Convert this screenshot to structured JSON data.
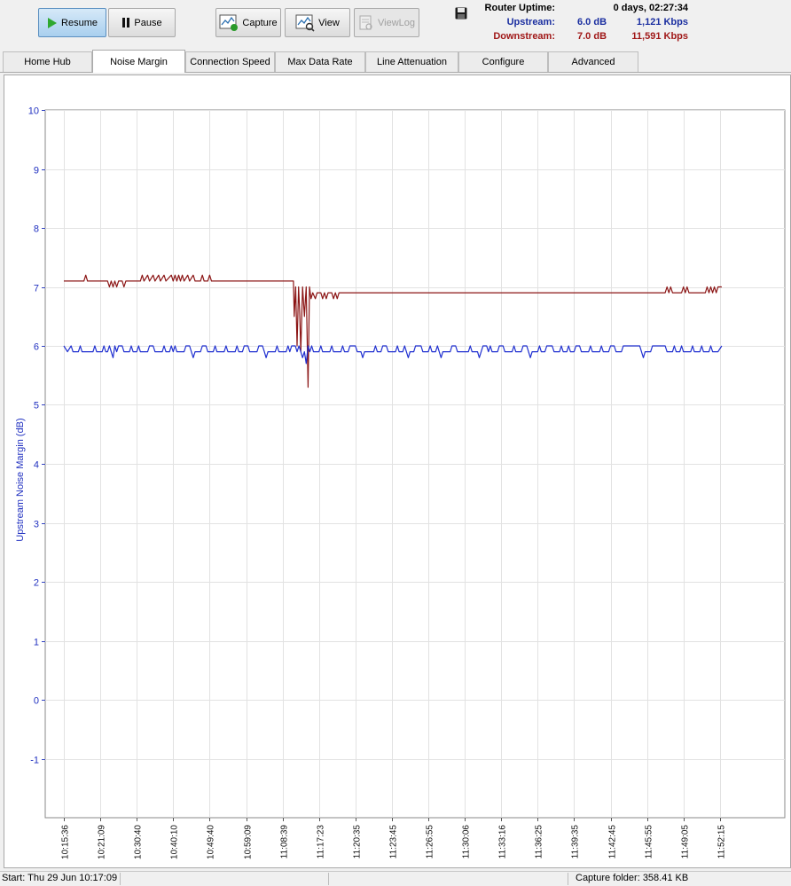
{
  "toolbar": {
    "resume_label": "Resume",
    "pause_label": "Pause",
    "capture_label": "Capture",
    "view_label": "View",
    "viewlog_label": "ViewLog"
  },
  "status": {
    "uptime_label": "Router Uptime:",
    "uptime_value": "0 days, 02:27:34",
    "upstream_label": "Upstream:",
    "upstream_db": "6.0 dB",
    "upstream_kbps": "1,121 Kbps",
    "downstream_label": "Downstream:",
    "downstream_db": "7.0 dB",
    "downstream_kbps": "11,591 Kbps"
  },
  "tabs": [
    {
      "label": "Home Hub"
    },
    {
      "label": "Noise Margin"
    },
    {
      "label": "Connection Speed"
    },
    {
      "label": "Max Data Rate"
    },
    {
      "label": "Line Attenuation"
    },
    {
      "label": "Configure"
    },
    {
      "label": "Advanced"
    }
  ],
  "statusbar": {
    "start": "Start: Thu 29 Jun 10:17:09",
    "capture_folder": "Capture folder:  358.41 KB"
  },
  "colors": {
    "upstream": "#1f2fd0",
    "downstream": "#8b1515",
    "accent": "#2a7a2a"
  },
  "chart_data": {
    "type": "line",
    "ylabel": "Upstream Noise Margin (dB)",
    "ylim": [
      -2,
      10
    ],
    "yticks": [
      10,
      9,
      8,
      7,
      6,
      5,
      4,
      3,
      2,
      1,
      0,
      -1
    ],
    "grid": true,
    "xticks": [
      "10:15:36",
      "10:21:09",
      "10:30:40",
      "10:40:10",
      "10:49:40",
      "10:59:09",
      "11:08:39",
      "11:17:23",
      "11:20:35",
      "11:23:45",
      "11:26:55",
      "11:30:06",
      "11:33:16",
      "11:36:25",
      "11:39:35",
      "11:42:45",
      "11:45:55",
      "11:49:05",
      "11:52:15"
    ],
    "series": [
      {
        "key": "downstream",
        "points": [
          [
            0,
            7.1
          ],
          [
            0.55,
            7.1
          ],
          [
            0.6,
            7.2
          ],
          [
            0.65,
            7.1
          ],
          [
            1.2,
            7.1
          ],
          [
            1.25,
            7.0
          ],
          [
            1.3,
            7.1
          ],
          [
            1.35,
            7.0
          ],
          [
            1.4,
            7.1
          ],
          [
            1.45,
            7.0
          ],
          [
            1.5,
            7.1
          ],
          [
            1.6,
            7.1
          ],
          [
            1.65,
            7.0
          ],
          [
            1.7,
            7.1
          ],
          [
            2.1,
            7.1
          ],
          [
            2.15,
            7.2
          ],
          [
            2.2,
            7.1
          ],
          [
            2.3,
            7.2
          ],
          [
            2.35,
            7.1
          ],
          [
            2.45,
            7.2
          ],
          [
            2.5,
            7.1
          ],
          [
            2.6,
            7.2
          ],
          [
            2.65,
            7.1
          ],
          [
            2.75,
            7.2
          ],
          [
            2.8,
            7.1
          ],
          [
            2.95,
            7.2
          ],
          [
            3.0,
            7.1
          ],
          [
            3.05,
            7.2
          ],
          [
            3.1,
            7.1
          ],
          [
            3.15,
            7.2
          ],
          [
            3.2,
            7.1
          ],
          [
            3.25,
            7.2
          ],
          [
            3.3,
            7.1
          ],
          [
            3.4,
            7.2
          ],
          [
            3.45,
            7.1
          ],
          [
            3.55,
            7.2
          ],
          [
            3.6,
            7.1
          ],
          [
            3.65,
            7.1
          ],
          [
            3.75,
            7.1
          ],
          [
            3.8,
            7.2
          ],
          [
            3.85,
            7.1
          ],
          [
            3.95,
            7.1
          ],
          [
            4.0,
            7.2
          ],
          [
            4.05,
            7.1
          ],
          [
            6.3,
            7.1
          ],
          [
            6.32,
            6.5
          ],
          [
            6.36,
            7.0
          ],
          [
            6.4,
            6.0
          ],
          [
            6.44,
            7.0
          ],
          [
            6.47,
            6.6
          ],
          [
            6.5,
            5.9
          ],
          [
            6.55,
            7.0
          ],
          [
            6.6,
            6.5
          ],
          [
            6.65,
            7.0
          ],
          [
            6.7,
            5.3
          ],
          [
            6.74,
            7.0
          ],
          [
            6.78,
            6.8
          ],
          [
            6.83,
            6.9
          ],
          [
            6.9,
            6.8
          ],
          [
            6.95,
            6.9
          ],
          [
            7.05,
            6.9
          ],
          [
            7.1,
            6.8
          ],
          [
            7.15,
            6.9
          ],
          [
            7.2,
            6.8
          ],
          [
            7.25,
            6.9
          ],
          [
            7.35,
            6.9
          ],
          [
            7.4,
            6.8
          ],
          [
            7.45,
            6.9
          ],
          [
            7.5,
            6.8
          ],
          [
            7.55,
            6.9
          ],
          [
            16.5,
            6.9
          ],
          [
            16.55,
            7.0
          ],
          [
            16.6,
            6.9
          ],
          [
            16.65,
            7.0
          ],
          [
            16.7,
            6.9
          ],
          [
            16.95,
            6.9
          ],
          [
            17.0,
            7.0
          ],
          [
            17.05,
            6.9
          ],
          [
            17.1,
            7.0
          ],
          [
            17.15,
            6.9
          ],
          [
            17.6,
            6.9
          ],
          [
            17.65,
            7.0
          ],
          [
            17.7,
            6.9
          ],
          [
            17.75,
            7.0
          ],
          [
            17.8,
            6.9
          ],
          [
            17.85,
            7.0
          ],
          [
            17.9,
            6.9
          ],
          [
            17.95,
            7.0
          ],
          [
            18.05,
            7.0
          ]
        ]
      },
      {
        "key": "upstream",
        "points": [
          [
            0,
            6.0
          ],
          [
            0.1,
            5.9
          ],
          [
            0.2,
            6.0
          ],
          [
            0.25,
            5.9
          ],
          [
            0.4,
            5.9
          ],
          [
            0.45,
            6.0
          ],
          [
            0.5,
            5.9
          ],
          [
            0.8,
            5.9
          ],
          [
            0.85,
            6.0
          ],
          [
            0.9,
            5.9
          ],
          [
            1.05,
            5.9
          ],
          [
            1.1,
            6.0
          ],
          [
            1.15,
            5.9
          ],
          [
            1.2,
            5.9
          ],
          [
            1.25,
            6.0
          ],
          [
            1.3,
            5.9
          ],
          [
            1.35,
            5.8
          ],
          [
            1.4,
            6.0
          ],
          [
            1.45,
            5.9
          ],
          [
            1.5,
            6.0
          ],
          [
            1.6,
            6.0
          ],
          [
            1.65,
            5.9
          ],
          [
            1.8,
            5.9
          ],
          [
            1.85,
            6.0
          ],
          [
            1.9,
            5.9
          ],
          [
            2.0,
            5.9
          ],
          [
            2.05,
            6.0
          ],
          [
            2.1,
            5.9
          ],
          [
            2.3,
            5.9
          ],
          [
            2.35,
            6.0
          ],
          [
            2.45,
            6.0
          ],
          [
            2.5,
            5.9
          ],
          [
            2.7,
            5.9
          ],
          [
            2.75,
            6.0
          ],
          [
            2.8,
            5.9
          ],
          [
            2.9,
            5.9
          ],
          [
            2.95,
            6.0
          ],
          [
            3.0,
            5.9
          ],
          [
            3.05,
            6.0
          ],
          [
            3.1,
            5.9
          ],
          [
            3.3,
            5.9
          ],
          [
            3.35,
            6.0
          ],
          [
            3.45,
            6.0
          ],
          [
            3.5,
            5.9
          ],
          [
            3.55,
            5.8
          ],
          [
            3.6,
            5.9
          ],
          [
            3.75,
            5.9
          ],
          [
            3.8,
            6.0
          ],
          [
            3.9,
            6.0
          ],
          [
            3.95,
            5.9
          ],
          [
            4.1,
            5.9
          ],
          [
            4.15,
            6.0
          ],
          [
            4.2,
            5.9
          ],
          [
            4.4,
            5.9
          ],
          [
            4.45,
            6.0
          ],
          [
            4.5,
            5.9
          ],
          [
            4.7,
            5.9
          ],
          [
            4.75,
            6.0
          ],
          [
            4.8,
            5.9
          ],
          [
            4.9,
            5.9
          ],
          [
            4.95,
            6.0
          ],
          [
            5.05,
            6.0
          ],
          [
            5.1,
            5.9
          ],
          [
            5.3,
            5.9
          ],
          [
            5.35,
            6.0
          ],
          [
            5.45,
            6.0
          ],
          [
            5.5,
            5.9
          ],
          [
            5.55,
            5.8
          ],
          [
            5.6,
            5.9
          ],
          [
            5.8,
            5.9
          ],
          [
            5.85,
            6.0
          ],
          [
            5.9,
            5.9
          ],
          [
            6.1,
            5.9
          ],
          [
            6.15,
            6.0
          ],
          [
            6.2,
            5.9
          ],
          [
            6.25,
            6.0
          ],
          [
            6.35,
            6.0
          ],
          [
            6.4,
            5.9
          ],
          [
            6.45,
            6.0
          ],
          [
            6.5,
            5.9
          ],
          [
            6.55,
            5.8
          ],
          [
            6.6,
            5.9
          ],
          [
            6.65,
            5.7
          ],
          [
            6.7,
            6.0
          ],
          [
            6.75,
            5.9
          ],
          [
            6.8,
            6.0
          ],
          [
            6.85,
            5.9
          ],
          [
            7.0,
            5.9
          ],
          [
            7.05,
            6.0
          ],
          [
            7.1,
            5.9
          ],
          [
            7.3,
            5.9
          ],
          [
            7.35,
            6.0
          ],
          [
            7.4,
            5.9
          ],
          [
            7.6,
            5.9
          ],
          [
            7.65,
            6.0
          ],
          [
            7.7,
            5.9
          ],
          [
            7.8,
            5.9
          ],
          [
            7.85,
            6.0
          ],
          [
            8.0,
            6.0
          ],
          [
            8.05,
            5.9
          ],
          [
            8.15,
            5.9
          ],
          [
            8.2,
            5.8
          ],
          [
            8.25,
            5.9
          ],
          [
            8.5,
            5.9
          ],
          [
            8.55,
            6.0
          ],
          [
            8.6,
            5.9
          ],
          [
            8.7,
            5.9
          ],
          [
            8.75,
            6.0
          ],
          [
            8.85,
            6.0
          ],
          [
            8.9,
            5.9
          ],
          [
            9.1,
            5.9
          ],
          [
            9.15,
            6.0
          ],
          [
            9.2,
            5.9
          ],
          [
            9.3,
            5.9
          ],
          [
            9.35,
            6.0
          ],
          [
            9.4,
            5.9
          ],
          [
            9.45,
            5.8
          ],
          [
            9.5,
            5.9
          ],
          [
            9.6,
            5.9
          ],
          [
            9.65,
            6.0
          ],
          [
            9.8,
            6.0
          ],
          [
            9.85,
            5.9
          ],
          [
            10.0,
            5.9
          ],
          [
            10.05,
            6.0
          ],
          [
            10.1,
            5.9
          ],
          [
            10.2,
            5.9
          ],
          [
            10.25,
            6.0
          ],
          [
            10.3,
            5.9
          ],
          [
            10.35,
            5.8
          ],
          [
            10.4,
            5.9
          ],
          [
            10.6,
            5.9
          ],
          [
            10.65,
            6.0
          ],
          [
            10.75,
            6.0
          ],
          [
            10.8,
            5.9
          ],
          [
            11.1,
            5.9
          ],
          [
            11.15,
            6.0
          ],
          [
            11.2,
            5.9
          ],
          [
            11.35,
            5.9
          ],
          [
            11.4,
            5.8
          ],
          [
            11.45,
            5.9
          ],
          [
            11.5,
            6.0
          ],
          [
            11.6,
            6.0
          ],
          [
            11.65,
            5.9
          ],
          [
            11.7,
            6.0
          ],
          [
            11.75,
            5.9
          ],
          [
            11.9,
            5.9
          ],
          [
            11.95,
            6.0
          ],
          [
            12.05,
            6.0
          ],
          [
            12.1,
            5.9
          ],
          [
            12.3,
            5.9
          ],
          [
            12.35,
            6.0
          ],
          [
            12.4,
            5.9
          ],
          [
            12.55,
            5.9
          ],
          [
            12.6,
            6.0
          ],
          [
            12.7,
            6.0
          ],
          [
            12.75,
            5.9
          ],
          [
            12.8,
            5.8
          ],
          [
            12.85,
            5.9
          ],
          [
            13.0,
            5.9
          ],
          [
            13.05,
            6.0
          ],
          [
            13.1,
            5.9
          ],
          [
            13.2,
            5.9
          ],
          [
            13.25,
            6.0
          ],
          [
            13.4,
            6.0
          ],
          [
            13.45,
            5.9
          ],
          [
            13.6,
            5.9
          ],
          [
            13.65,
            6.0
          ],
          [
            13.7,
            5.9
          ],
          [
            13.8,
            5.9
          ],
          [
            13.85,
            6.0
          ],
          [
            13.9,
            5.9
          ],
          [
            14.0,
            5.9
          ],
          [
            14.05,
            6.0
          ],
          [
            14.15,
            6.0
          ],
          [
            14.2,
            5.9
          ],
          [
            14.4,
            5.9
          ],
          [
            14.45,
            6.0
          ],
          [
            14.5,
            5.9
          ],
          [
            14.7,
            5.9
          ],
          [
            14.75,
            6.0
          ],
          [
            14.8,
            5.9
          ],
          [
            14.95,
            5.9
          ],
          [
            15.0,
            6.0
          ],
          [
            15.1,
            6.0
          ],
          [
            15.15,
            5.9
          ],
          [
            15.3,
            5.9
          ],
          [
            15.35,
            6.0
          ],
          [
            15.8,
            6.0
          ],
          [
            15.85,
            5.9
          ],
          [
            15.9,
            5.8
          ],
          [
            15.95,
            5.9
          ],
          [
            16.1,
            5.9
          ],
          [
            16.15,
            6.0
          ],
          [
            16.5,
            6.0
          ],
          [
            16.55,
            5.9
          ],
          [
            16.7,
            5.9
          ],
          [
            16.75,
            6.0
          ],
          [
            16.8,
            5.9
          ],
          [
            16.9,
            5.9
          ],
          [
            16.95,
            6.0
          ],
          [
            17.0,
            5.9
          ],
          [
            17.2,
            5.9
          ],
          [
            17.25,
            6.0
          ],
          [
            17.3,
            5.9
          ],
          [
            17.45,
            5.9
          ],
          [
            17.5,
            6.0
          ],
          [
            17.55,
            5.9
          ],
          [
            17.7,
            5.9
          ],
          [
            17.75,
            6.0
          ],
          [
            17.8,
            5.9
          ],
          [
            17.95,
            5.9
          ],
          [
            18.05,
            6.0
          ]
        ]
      }
    ]
  }
}
